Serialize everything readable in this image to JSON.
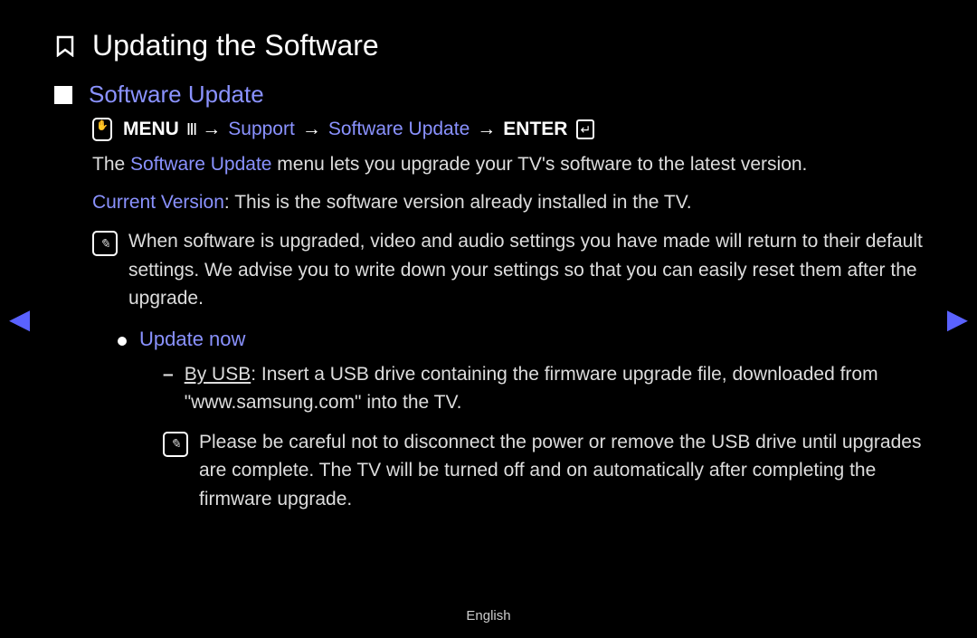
{
  "page": {
    "title": "Updating the Software",
    "section_title": "Software Update",
    "path": {
      "menu_label": "MENU",
      "step1": "Support",
      "step2": "Software Update",
      "enter_label": "ENTER",
      "arrow": "→"
    },
    "intro_prefix": "The ",
    "intro_highlight": "Software Update",
    "intro_suffix": " menu lets you upgrade your TV's software to the latest version.",
    "current_version_label": "Current Version",
    "current_version_text": ": This is the software version already installed in the TV.",
    "note1": "When software is upgraded, video and audio settings you have made will return to their default settings. We advise you to write down your settings so that you can easily reset them after the upgrade.",
    "update_now_label": "Update now",
    "by_usb_label": "By USB",
    "by_usb_text": ": Insert a USB drive containing the firmware upgrade file, downloaded from \"www.samsung.com\" into the TV.",
    "note2": "Please be careful not to disconnect the power or remove the USB drive until upgrades are complete. The TV will be turned off and on automatically after completing the firmware upgrade.",
    "footer_language": "English"
  },
  "nav": {
    "prev": "◀",
    "next": "▶"
  }
}
